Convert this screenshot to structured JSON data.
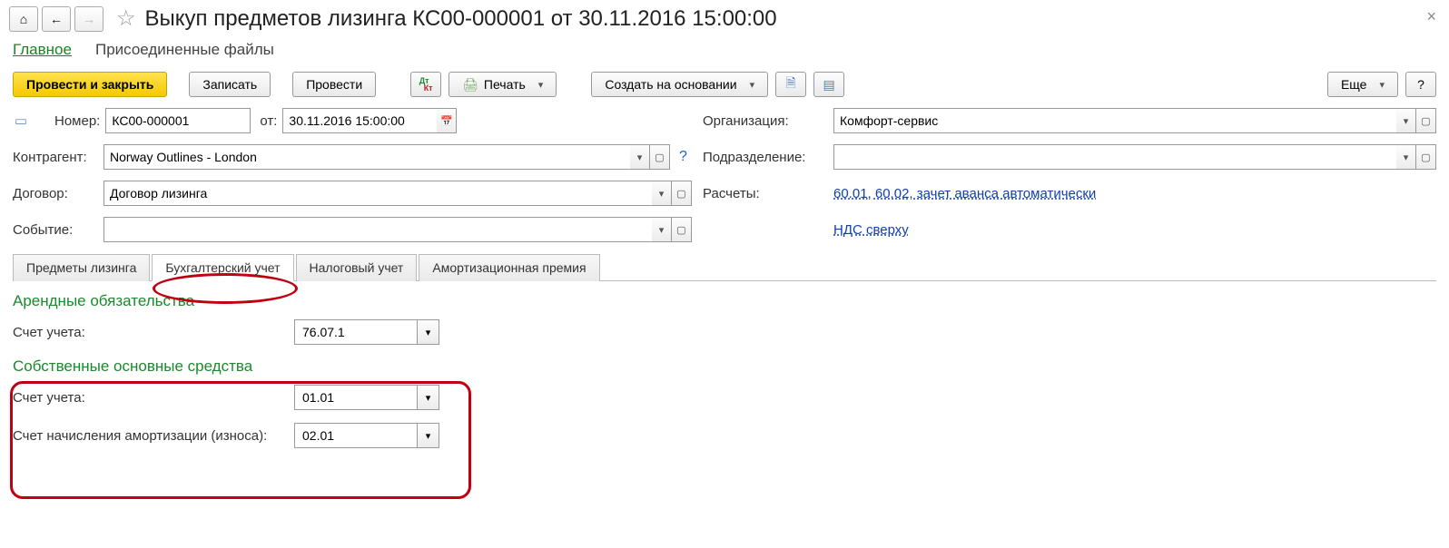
{
  "header": {
    "title": "Выкуп предметов лизинга КС00-000001 от 30.11.2016 15:00:00"
  },
  "nav": {
    "main": "Главное",
    "files": "Присоединенные файлы"
  },
  "toolbar": {
    "post_and_close": "Провести и закрыть",
    "write": "Записать",
    "post": "Провести",
    "print": "Печать",
    "create_based_on": "Создать на основании",
    "more": "Еще",
    "help": "?"
  },
  "form": {
    "number_label": "Номер:",
    "number_value": "КС00-000001",
    "date_label": "от:",
    "date_value": "30.11.2016 15:00:00",
    "org_label": "Организация:",
    "org_value": "Комфорт-сервис",
    "contragent_label": "Контрагент:",
    "contragent_value": "Norway Outlines - London",
    "division_label": "Подразделение:",
    "division_value": "",
    "contract_label": "Договор:",
    "contract_value": "Договор лизинга",
    "settlements_label": "Расчеты:",
    "settlements_link": "60.01, 60.02, зачет аванса автоматически",
    "event_label": "Событие:",
    "event_value": "",
    "vat_link": "НДС сверху"
  },
  "tabs": {
    "t1": "Предметы лизинга",
    "t2": "Бухгалтерский учет",
    "t3": "Налоговый учет",
    "t4": "Амортизационная премия"
  },
  "acct": {
    "section1_title": "Арендные обязательства",
    "acc_label": "Счет учета:",
    "acc1_value": "76.07.1",
    "section2_title": "Собственные основные средства",
    "acc2_value": "01.01",
    "depr_label": "Счет начисления амортизации (износа):",
    "depr_value": "02.01"
  }
}
